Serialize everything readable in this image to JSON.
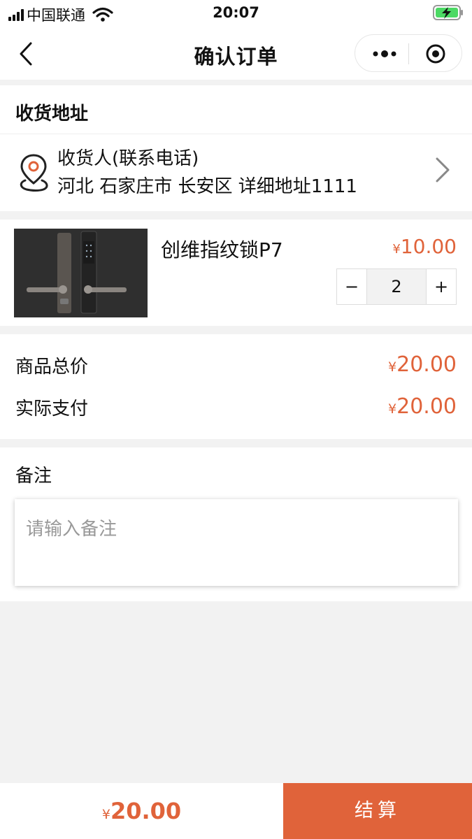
{
  "status_bar": {
    "carrier": "中国联通",
    "time": "20:07"
  },
  "nav": {
    "title": "确认订单"
  },
  "address": {
    "section_title": "收货地址",
    "recipient": "收货人(联系电话)",
    "detail": "河北 石家庄市 长安区 详细地址1111"
  },
  "product": {
    "name": "创维指纹锁P7",
    "currency": "¥",
    "price": "10.00",
    "quantity": "2",
    "minus_label": "−",
    "plus_label": "+"
  },
  "totals": {
    "goods_label": "商品总价",
    "goods_currency": "¥",
    "goods_value": "20.00",
    "paid_label": "实际支付",
    "paid_currency": "¥",
    "paid_value": "20.00"
  },
  "remark": {
    "label": "备注",
    "placeholder": "请输入备注"
  },
  "bottom": {
    "currency": "¥",
    "total": "20.00",
    "checkout_label": "结算"
  },
  "colors": {
    "accent": "#e0633a",
    "background": "#f2f2f2"
  }
}
